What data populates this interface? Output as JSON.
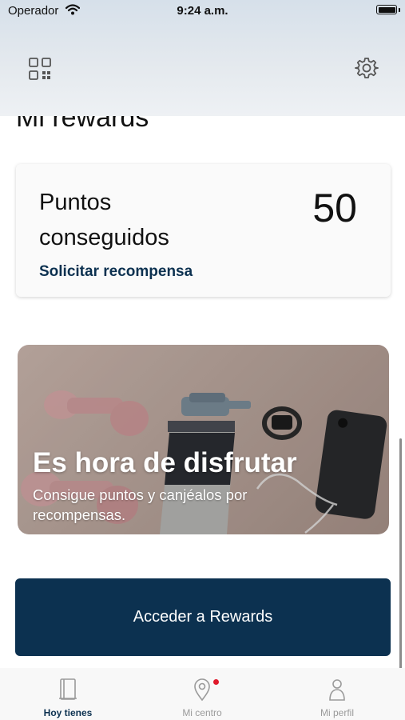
{
  "status_bar": {
    "carrier": "Operador",
    "time": "9:24 a.m."
  },
  "header": {
    "qr_icon": "qr-code-icon",
    "settings_icon": "gear-icon"
  },
  "page": {
    "title": "Mi rewards"
  },
  "points_card": {
    "label": "Puntos conseguidos",
    "value": "50",
    "action_label": "Solicitar recompensa"
  },
  "promo": {
    "title": "Es hora de disfrutar",
    "subtitle": "Consigue puntos y canjéalos por recompensas."
  },
  "cta": {
    "label": "Acceder a Rewards"
  },
  "tab_bar": {
    "tabs": [
      {
        "label": "Hoy tienes",
        "icon": "notebook-icon",
        "active": true
      },
      {
        "label": "Mi centro",
        "icon": "location-pin-icon",
        "active": false,
        "badge": true
      },
      {
        "label": "Mi perfil",
        "icon": "person-icon",
        "active": false
      }
    ]
  },
  "colors": {
    "primary": "#0c3150",
    "badge": "#e0192b",
    "inactive_tab": "#9a9a9a"
  }
}
